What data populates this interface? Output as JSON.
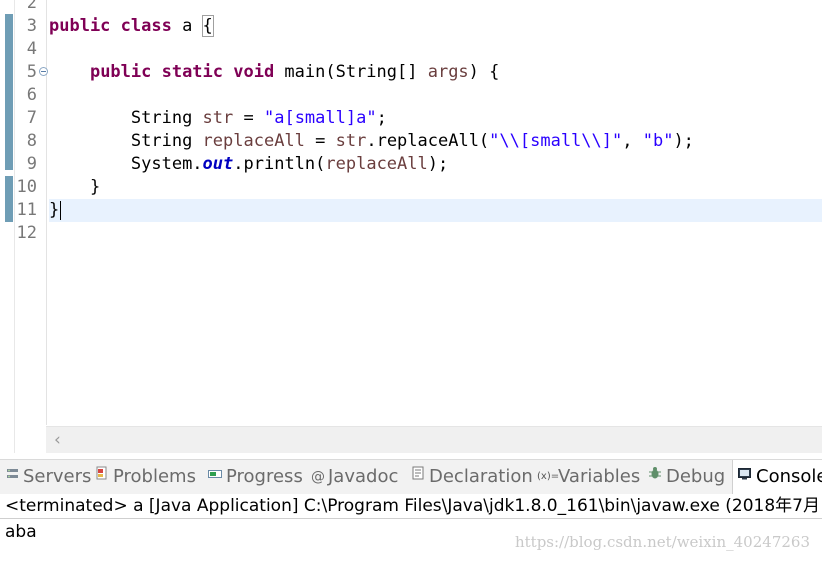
{
  "editor": {
    "line_numbers": [
      "2",
      "3",
      "4",
      "5",
      "6",
      "7",
      "8",
      "9",
      "10",
      "11",
      "12"
    ],
    "code": {
      "l3_kw": "public class",
      "l3_rest": " a ",
      "l3_brace": "{",
      "l5_indent": "    ",
      "l5_kw": "public static void",
      "l5_rest": " main(String[] ",
      "l5_arg": "args",
      "l5_end": ") {",
      "l7_indent": "        ",
      "l7_type": "String ",
      "l7_var": "str",
      "l7_eq": " = ",
      "l7_str": "\"a[small]a\"",
      "l7_end": ";",
      "l8_indent": "        ",
      "l8_type": "String ",
      "l8_var": "replaceAll",
      "l8_eq": " = ",
      "l8_recv": "str",
      "l8_call": ".replaceAll(",
      "l8_str1": "\"\\\\[small\\\\]\"",
      "l8_comma": ", ",
      "l8_str2": "\"b\"",
      "l8_end": ");",
      "l9_indent": "        ",
      "l9_sys": "System.",
      "l9_out": "out",
      "l9_call": ".println(",
      "l9_arg": "replaceAll",
      "l9_end": ");",
      "l10": "    }",
      "l11": "}"
    }
  },
  "views": {
    "tabs": [
      {
        "icon": "servers-icon",
        "label": "Servers"
      },
      {
        "icon": "problems-icon",
        "label": "Problems"
      },
      {
        "icon": "progress-icon",
        "label": "Progress"
      },
      {
        "icon": "javadoc-icon",
        "label": "Javadoc"
      },
      {
        "icon": "declaration-icon",
        "label": "Declaration"
      },
      {
        "icon": "variables-icon",
        "label": "Variables"
      },
      {
        "icon": "debug-icon",
        "label": "Debug"
      },
      {
        "icon": "console-icon",
        "label": "Console"
      }
    ],
    "active": "Console"
  },
  "console": {
    "header": "<terminated> a [Java Application] C:\\Program Files\\Java\\jdk1.8.0_161\\bin\\javaw.exe (2018年7月",
    "output": "aba"
  },
  "watermark": "https://blog.csdn.net/weixin_40247263",
  "colors": {
    "keyword": "#7f0055",
    "string": "#2a00ff",
    "field": "#0000c0",
    "local_variable": "#6a3e3e",
    "current_line": "#e8f2fe",
    "quick_diff": "#6f9db5"
  }
}
